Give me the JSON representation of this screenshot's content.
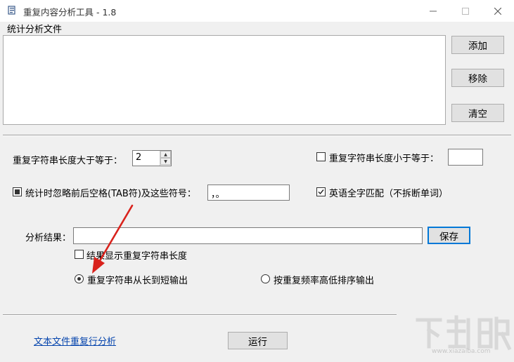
{
  "window": {
    "title": "重复内容分析工具 - 1.8",
    "min_icon": "minimize-icon",
    "max_icon": "maximize-icon",
    "close_icon": "close-icon"
  },
  "files": {
    "label": "统计分析文件",
    "add": "添加",
    "remove": "移除",
    "clear": "清空"
  },
  "options": {
    "min_len_label": "重复字符串长度大于等于：",
    "min_len_value": "2",
    "max_len_label": "重复字符串长度小于等于：",
    "max_len_value": "",
    "max_len_checked": false,
    "ignore_label": "统计时忽略前后空格(TAB符)及这些符号：",
    "ignore_value": "，。",
    "ignore_state": "indeterminate",
    "english_label": "英语全字匹配（不拆断单词）",
    "english_checked": true
  },
  "result": {
    "label": "分析结果：",
    "value": "",
    "save": "保存",
    "show_length_label": "结果显示重复字符串长度",
    "show_length_checked": false,
    "order_long_short": "重复字符串从长到短输出",
    "order_frequency": "按重复频率高低排序输出",
    "selected_order": "long_short"
  },
  "footer": {
    "link": "文本文件重复行分析",
    "run": "运行"
  },
  "colors": {
    "accent": "#0078d7",
    "arrow": "#d9221c",
    "link": "#0645ad"
  },
  "watermark": {
    "text": "下载吧",
    "url": "www.xiazaiba.com"
  }
}
